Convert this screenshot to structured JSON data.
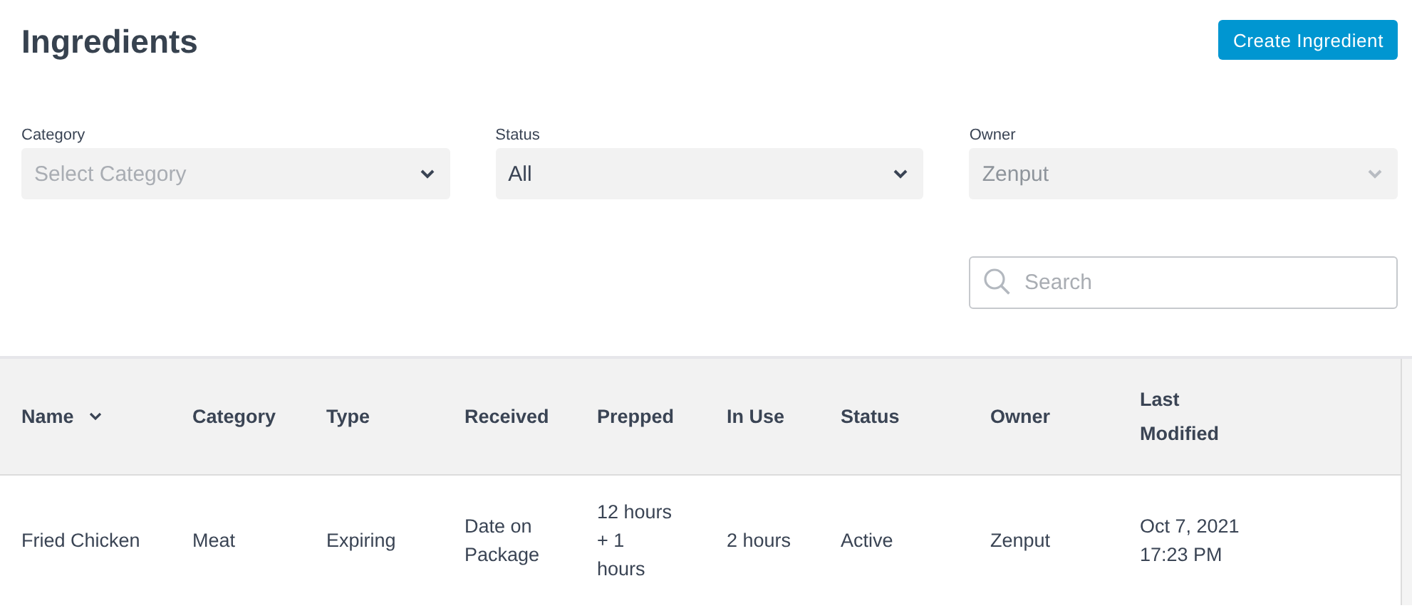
{
  "page": {
    "title": "Ingredients",
    "create_button": "Create Ingredient"
  },
  "filters": [
    {
      "label": "Category",
      "placeholder": "Select Category",
      "disabled": false
    },
    {
      "label": "Status",
      "value": "All",
      "disabled": false
    },
    {
      "label": "Owner",
      "value": "Zenput",
      "disabled": true
    }
  ],
  "search": {
    "placeholder": "Search"
  },
  "table": {
    "columns": [
      {
        "label": "Name",
        "sorted": true
      },
      {
        "label": "Category",
        "sorted": false
      },
      {
        "label": "Type",
        "sorted": false
      },
      {
        "label": "Received",
        "sorted": false
      },
      {
        "label": "Prepped",
        "sorted": false
      },
      {
        "label": "In Use",
        "sorted": false
      },
      {
        "label": "Status",
        "sorted": false
      },
      {
        "label": "Owner",
        "sorted": false
      },
      {
        "label": "Last Modified",
        "sorted": false
      }
    ],
    "rows": [
      [
        "Fried Chicken",
        "Meat",
        "Expiring",
        "Date on Package",
        "12 hours + 1 hours",
        "2 hours",
        "Active",
        "Zenput",
        "Oct 7, 2021 17:23 PM"
      ]
    ]
  }
}
